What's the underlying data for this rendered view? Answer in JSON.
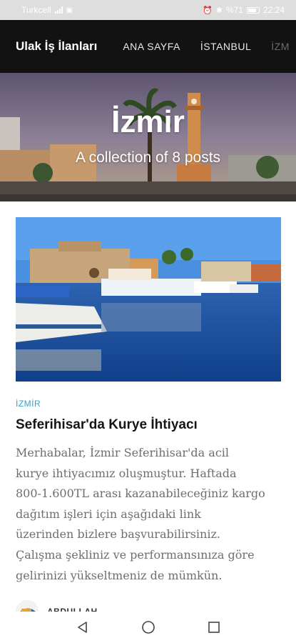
{
  "status_bar": {
    "carrier": "Turkcell",
    "battery": "%71",
    "time": "22:24",
    "icons": [
      "signal-icon",
      "nfc-icon",
      "alarm-icon",
      "bluetooth-icon",
      "battery-icon"
    ]
  },
  "nav": {
    "brand": "Ulak İş İlanları",
    "links": [
      "ANA SAYFA",
      "İSTANBUL",
      "İZM"
    ]
  },
  "hero": {
    "title": "İzmir",
    "subtitle": "A collection of 8 posts"
  },
  "post": {
    "tag": "İZMİR",
    "title": "Seferihisar'da Kurye İhtiyacı",
    "excerpt_lines": [
      "Merhabalar, İzmir Seferihisar'da acil",
      "kurye ihtiyacımız oluşmuştur. Haftada",
      "800-1.600TL arası kazanabileceğiniz kargo",
      "dağıtım işleri için aşağıdaki link",
      "üzerinden bizlere başvurabilirsiniz.",
      "Çalışma şekliniz ve performansınıza göre",
      "gelirinizi yükseltmeniz de mümkün."
    ],
    "author": "ABDULLAH"
  },
  "colors": {
    "nav_bg": "#121212",
    "tag": "#2aa3d4",
    "excerpt": "#6e6e6e"
  },
  "system_nav": [
    "back-icon",
    "home-icon",
    "recents-icon"
  ]
}
